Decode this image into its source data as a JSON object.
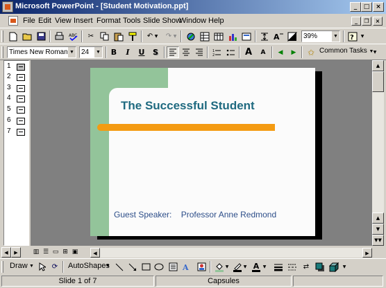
{
  "window": {
    "title": "Microsoft PowerPoint - [Student Motivation.ppt]"
  },
  "menus": [
    "File",
    "Edit",
    "View",
    "Insert",
    "Format",
    "Tools",
    "Slide Show",
    "Window",
    "Help"
  ],
  "standard_toolbar": {
    "zoom_value": "39%"
  },
  "formatting_toolbar": {
    "font_name": "Times New Roman",
    "font_size": "24",
    "bold_label": "B",
    "italic_label": "I",
    "underline_label": "U",
    "shadow_label": "S",
    "increase_font_label": "A",
    "decrease_font_label": "A",
    "common_tasks_label": "Common Tasks"
  },
  "outline": {
    "slide_numbers": [
      "1",
      "2",
      "3",
      "4",
      "5",
      "6",
      "7"
    ]
  },
  "slide": {
    "title": "The Successful Student",
    "subtitle": "Guest Speaker:    Professor Anne Redmond",
    "colors": {
      "green_bar": "#93c49a",
      "orange_line": "#f49b12",
      "title_text": "#1f6a80",
      "subtitle_text": "#2d4e89"
    }
  },
  "drawing_toolbar": {
    "draw_label": "Draw",
    "autoshapes_label": "AutoShapes",
    "font_color_label": "A"
  },
  "status_bar": {
    "slide_position": "Slide 1 of 7",
    "design_template": "Capsules"
  },
  "accent": "#0a246a"
}
